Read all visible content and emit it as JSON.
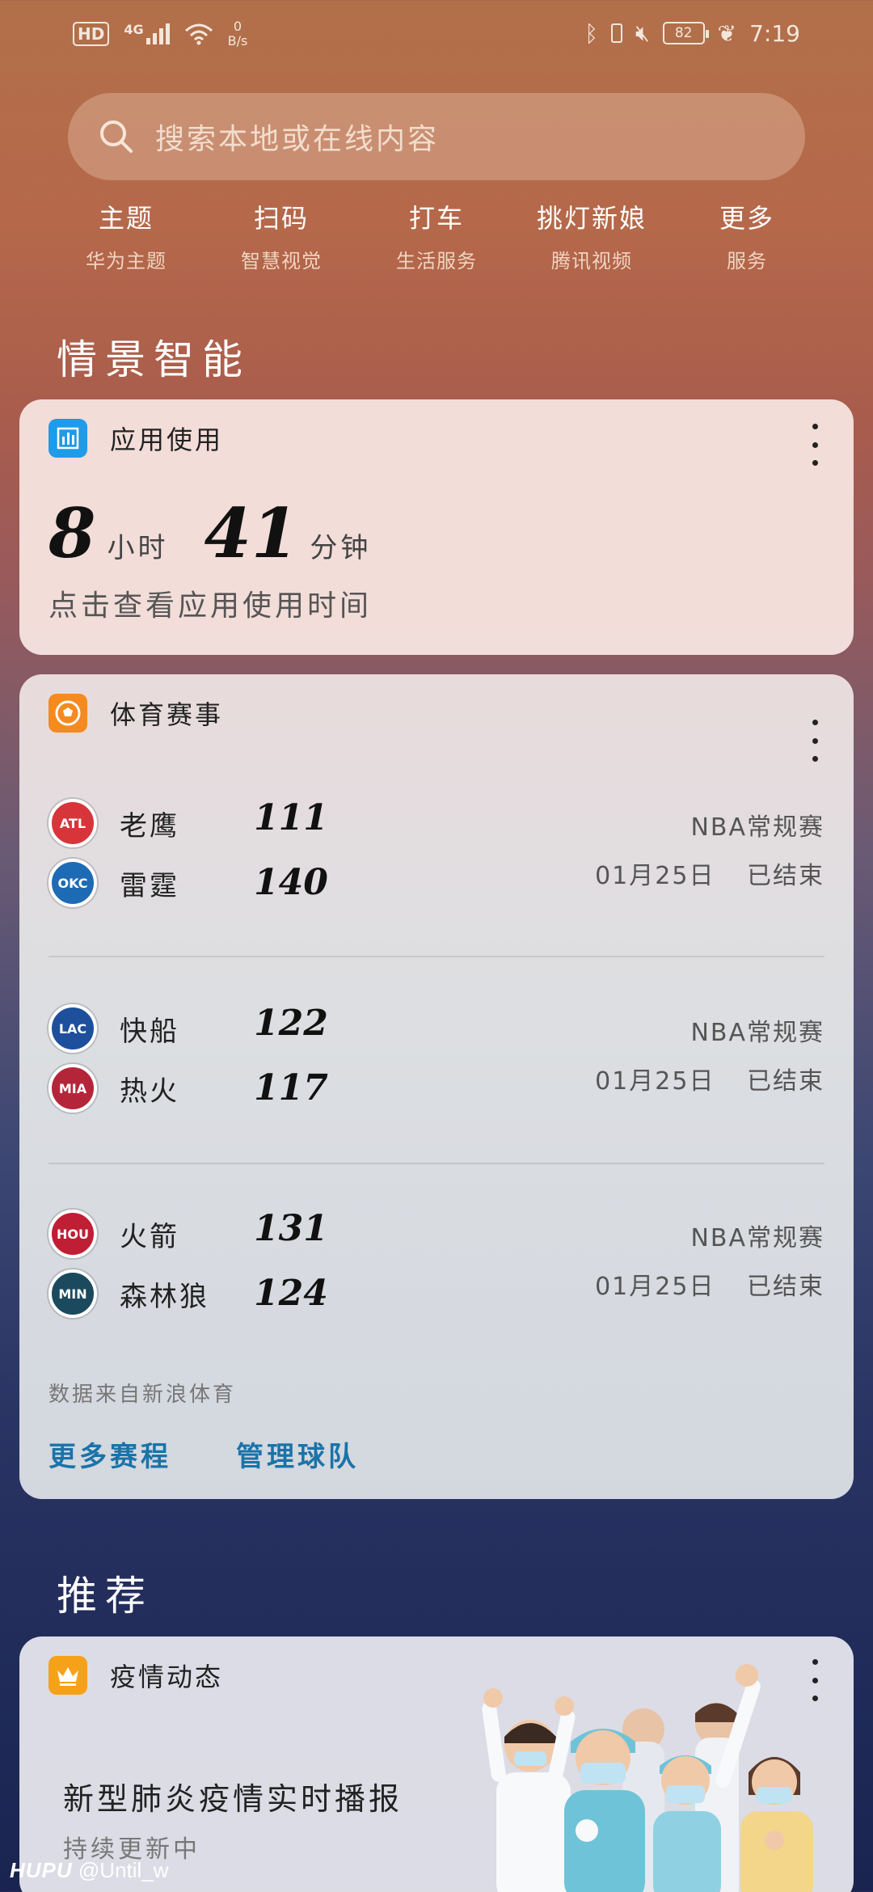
{
  "status_bar": {
    "hd": "HD",
    "network": "4G",
    "speed_value": "0",
    "speed_unit": "B/s",
    "battery": "82",
    "time": "7:19"
  },
  "search": {
    "placeholder": "搜索本地或在线内容"
  },
  "shortcuts": [
    {
      "title": "主题",
      "subtitle": "华为主题"
    },
    {
      "title": "扫码",
      "subtitle": "智慧视觉"
    },
    {
      "title": "打车",
      "subtitle": "生活服务"
    },
    {
      "title": "挑灯新娘",
      "subtitle": "腾讯视频"
    },
    {
      "title": "更多",
      "subtitle": "服务"
    }
  ],
  "sections": {
    "smart": "情景智能",
    "recommend": "推荐"
  },
  "usage_card": {
    "title": "应用使用",
    "hours": "8",
    "hours_unit": "小时",
    "minutes": "41",
    "minutes_unit": "分钟",
    "subtitle": "点击查看应用使用时间",
    "icon_color": "#1e9be9"
  },
  "sports_card": {
    "title": "体育赛事",
    "icon_color": "#f58a1f",
    "games": [
      {
        "home": {
          "name": "老鹰",
          "abbr": "ATL",
          "color": "#d8353a"
        },
        "away": {
          "name": "雷霆",
          "abbr": "OKC",
          "color": "#1d6bb5"
        },
        "home_score": "111",
        "away_score": "140",
        "type": "NBA常规赛",
        "date": "01月25日",
        "status": "已结束"
      },
      {
        "home": {
          "name": "快船",
          "abbr": "LAC",
          "color": "#1d4f9c"
        },
        "away": {
          "name": "热火",
          "abbr": "MIA",
          "color": "#b5253a"
        },
        "home_score": "122",
        "away_score": "117",
        "type": "NBA常规赛",
        "date": "01月25日",
        "status": "已结束"
      },
      {
        "home": {
          "name": "火箭",
          "abbr": "HOU",
          "color": "#bf1e35"
        },
        "away": {
          "name": "森林狼",
          "abbr": "MIN",
          "color": "#1b4a5e"
        },
        "home_score": "131",
        "away_score": "124",
        "type": "NBA常规赛",
        "date": "01月25日",
        "status": "已结束"
      }
    ],
    "source": "数据来自新浪体育",
    "more_schedule": "更多赛程",
    "manage_teams": "管理球队"
  },
  "news_card": {
    "title": "疫情动态",
    "icon_color": "#f5a21a",
    "headline": "新型肺炎疫情实时播报",
    "subtitle": "持续更新中"
  },
  "watermark": {
    "brand": "HUPU",
    "user": "@Until_w"
  }
}
